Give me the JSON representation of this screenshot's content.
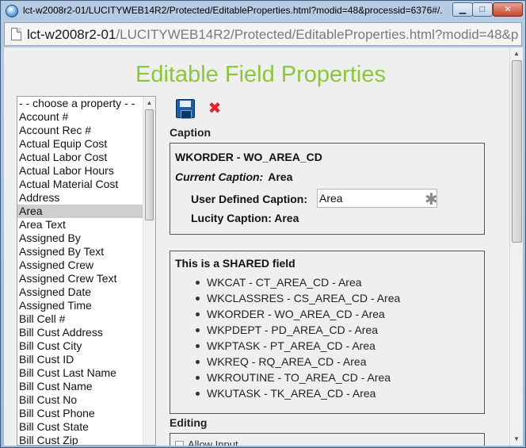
{
  "window": {
    "title": "lct-w2008r2-01/LUCITYWEB14R2/Protected/EditableProperties.html?modid=48&processid=6376#/..."
  },
  "address": {
    "host": "lct-w2008r2-01",
    "path": "/LUCITYWEB14R2/Protected/EditableProperties.html?modid=48&processi"
  },
  "page": {
    "heading": "Editable Field Properties"
  },
  "properties": {
    "items": [
      "- - choose a property - -",
      "Account #",
      "Account Rec #",
      "Actual Equip Cost",
      "Actual Labor Cost",
      "Actual Labor Hours",
      "Actual Material Cost",
      "Address",
      "Area",
      "Area Text",
      "Assigned By",
      "Assigned By Text",
      "Assigned Crew",
      "Assigned Crew Text",
      "Assigned Date",
      "Assigned Time",
      "Bill Cell #",
      "Bill Cust Address",
      "Bill Cust City",
      "Bill Cust ID",
      "Bill Cust Last Name",
      "Bill Cust Name",
      "Bill Cust No",
      "Bill Cust Phone",
      "Bill Cust State",
      "Bill Cust Zip"
    ],
    "selected": "Area"
  },
  "caption": {
    "section_label": "Caption",
    "title": "WKORDER - WO_AREA_CD",
    "current_label": "Current Caption:",
    "current_value": "Area",
    "user_defined_label": "User Defined Caption:",
    "user_defined_value": "Area",
    "lucity_caption": "Lucity Caption: Area"
  },
  "shared": {
    "title": "This is a SHARED field",
    "items": [
      "WKCAT - CT_AREA_CD - Area",
      "WKCLASSRES - CS_AREA_CD - Area",
      "WKORDER - WO_AREA_CD - Area",
      "WKPDEPT - PD_AREA_CD - Area",
      "WKPTASK - PT_AREA_CD - Area",
      "WKREQ - RQ_AREA_CD - Area",
      "WKROUTINE - TO_AREA_CD - Area",
      "WKUTASK - TK_AREA_CD - Area"
    ]
  },
  "editing": {
    "section_label": "Editing",
    "allow_label": "Allow Input"
  },
  "colors": {
    "heading": "#8cc63f",
    "delete_icon": "#e0242c",
    "save_icon": "#1c5fa8"
  },
  "icons": {
    "page": "page-icon",
    "save": "floppy-disk-icon",
    "delete": "red-x-icon",
    "required": "asterisk-icon"
  }
}
